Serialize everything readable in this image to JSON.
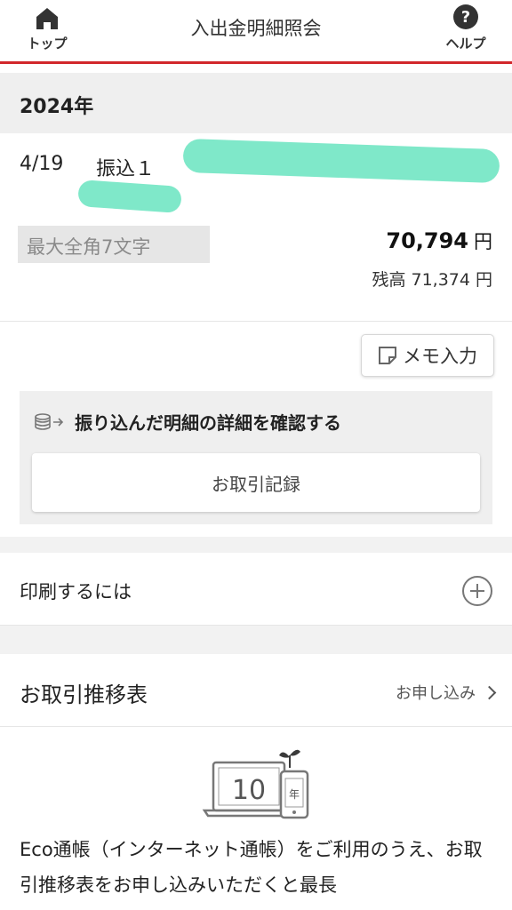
{
  "header": {
    "home_label": "トップ",
    "title": "入出金明細照会",
    "help_label": "ヘルプ"
  },
  "year": "2024年",
  "transaction": {
    "date": "4/19",
    "description": "振込１",
    "memo_placeholder": "最大全角7文字",
    "amount": "70,794",
    "currency": "円",
    "balance": "残高 71,374 円"
  },
  "memo_button": {
    "label": "メモ入力"
  },
  "detail": {
    "heading": "振り込んだ明細の詳細を確認する",
    "record_button": "お取引記録"
  },
  "print": {
    "label": "印刷するには"
  },
  "trend": {
    "label": "お取引推移表",
    "link": "お申し込み"
  },
  "eco": {
    "icon_number": "10",
    "icon_unit": "年",
    "text": "Eco通帳（インターネット通帳）をご利用のうえ、お取引推移表をお申し込みいただくと最長"
  },
  "colors": {
    "accent_red": "#d2272b",
    "redaction": "#7fe8c9",
    "section_gray": "#efefef"
  }
}
